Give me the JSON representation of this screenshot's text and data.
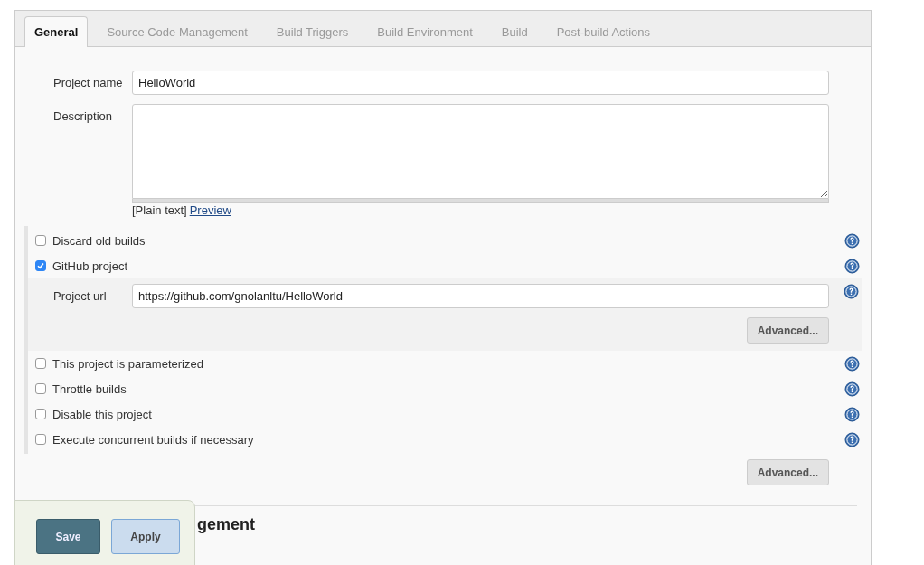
{
  "tabs": [
    {
      "label": "General",
      "selected": true
    },
    {
      "label": "Source Code Management",
      "selected": false
    },
    {
      "label": "Build Triggers",
      "selected": false
    },
    {
      "label": "Build Environment",
      "selected": false
    },
    {
      "label": "Build",
      "selected": false
    },
    {
      "label": "Post-build Actions",
      "selected": false
    }
  ],
  "project_name": {
    "label": "Project name",
    "value": "HelloWorld"
  },
  "description": {
    "label": "Description",
    "format_note": "[Plain text]",
    "preview_link": "Preview"
  },
  "options": [
    {
      "label": "Discard old builds",
      "checked": false
    },
    {
      "label": "GitHub project",
      "checked": true,
      "nested": {
        "label": "Project url",
        "value": "https://github.com/gnolanltu/HelloWorld",
        "button": "Advanced..."
      }
    },
    {
      "label": "This project is parameterized",
      "checked": false
    },
    {
      "label": "Throttle builds",
      "checked": false
    },
    {
      "label": "Disable this project",
      "checked": false
    },
    {
      "label": "Execute concurrent builds if necessary",
      "checked": false
    }
  ],
  "advanced_button": "Advanced...",
  "scm_section": {
    "heading": "gement"
  },
  "save_bar": {
    "save": "Save",
    "apply": "Apply"
  }
}
